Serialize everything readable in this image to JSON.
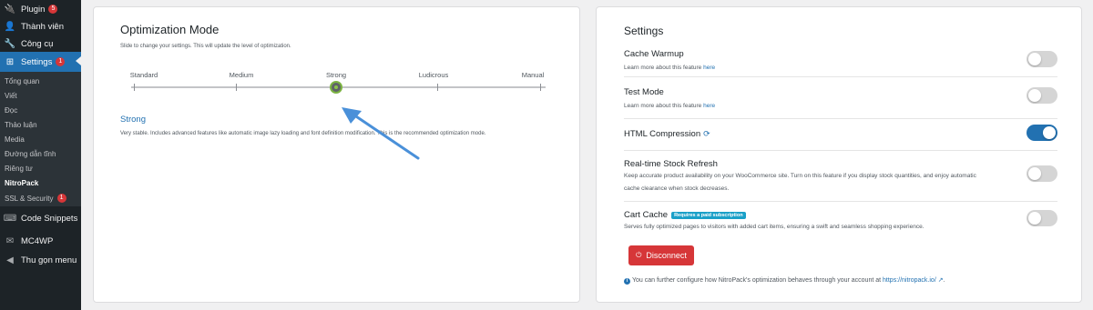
{
  "sidebar": {
    "menu": [
      {
        "label": "Plugin",
        "icon": "plug-icon",
        "badge": "5"
      },
      {
        "label": "Thành viên",
        "icon": "users-icon",
        "badge": ""
      },
      {
        "label": "Công cụ",
        "icon": "wrench-icon",
        "badge": ""
      },
      {
        "label": "Settings",
        "icon": "settings-icon",
        "badge": "1"
      }
    ],
    "submenu": [
      "Tổng quan",
      "Viết",
      "Đọc",
      "Thảo luận",
      "Media",
      "Đường dẫn tĩnh",
      "Riêng tư",
      "NitroPack",
      "SSL & Security"
    ],
    "submenu_badge": "1",
    "extra": [
      {
        "label": "Code Snippets",
        "icon": "code-icon"
      },
      {
        "label": "MC4WP",
        "icon": "mail-icon"
      },
      {
        "label": "Thu gọn menu",
        "icon": "collapse-icon"
      }
    ]
  },
  "optimization": {
    "title": "Optimization Mode",
    "subtitle": "Slide to change your settings. This will update the level of optimization.",
    "levels": [
      "Standard",
      "Medium",
      "Strong",
      "Ludicrous",
      "Manual"
    ],
    "selected_level": "Strong",
    "mode_name": "Strong",
    "mode_desc": "Very stable. Includes advanced features like automatic image lazy loading and font definition modification. This is the recommended optimization mode."
  },
  "settings": {
    "title": "Settings",
    "rows": [
      {
        "title": "Cache Warmup",
        "desc": "Learn more about this feature ",
        "link": "here",
        "on": false
      },
      {
        "title": "Test Mode",
        "desc": "Learn more about this feature ",
        "link": "here",
        "on": false
      },
      {
        "title": "HTML Compression",
        "desc": "",
        "link": "",
        "on": true
      },
      {
        "title": "Real-time Stock Refresh",
        "desc": "Keep accurate product availability on your WooCommerce site. Turn on this feature if you display stock quantities, and enjoy automatic cache clearance when stock decreases.",
        "link": "",
        "on": false
      },
      {
        "title": "Cart Cache",
        "badge": "Requires a paid subscription",
        "desc": "Serves fully optimized pages to visitors with added cart items, ensuring a swift and seamless shopping experience.",
        "link": "",
        "on": false
      }
    ],
    "disconnect_label": "Disconnect",
    "footer_text": "You can further configure how NitroPack's optimization behaves through your account at ",
    "footer_link": "https://nitropack.io/"
  },
  "colors": {
    "accent": "#2271b1",
    "danger": "#d63638",
    "sidebar": "#1d2327",
    "arrow": "#4a90d9"
  }
}
